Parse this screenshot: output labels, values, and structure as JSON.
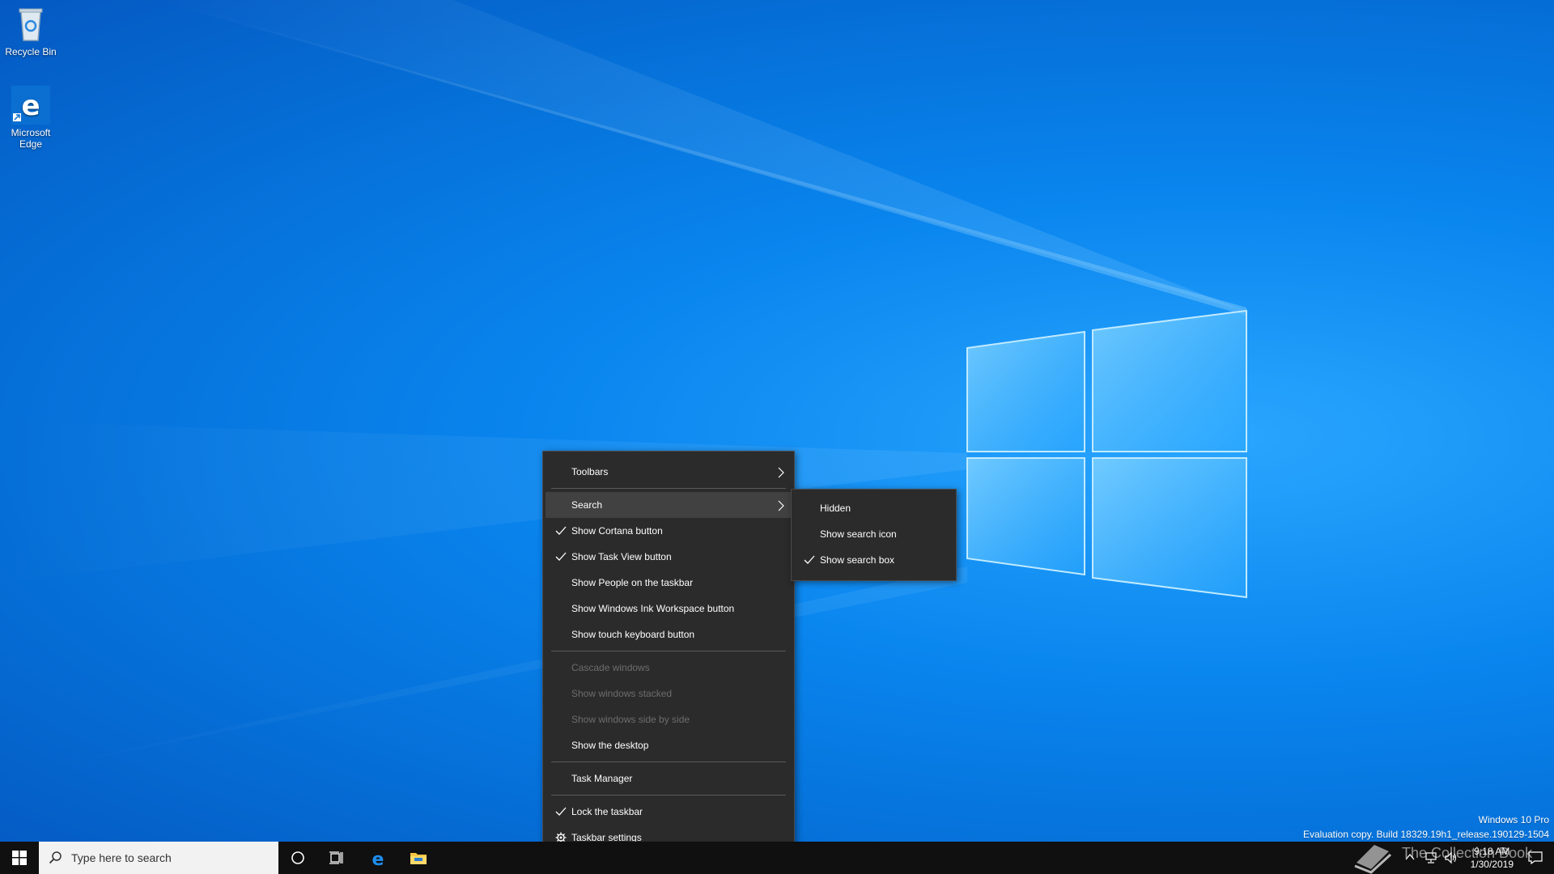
{
  "desktop": {
    "icons": [
      {
        "label": "Recycle Bin",
        "icon": "recycle-bin-icon"
      },
      {
        "label": "Microsoft Edge",
        "icon": "edge-icon"
      }
    ]
  },
  "context_menu": {
    "items": [
      {
        "label": "Toolbars",
        "checked": false,
        "submenu": true,
        "enabled": true
      },
      {
        "label": "Search",
        "checked": false,
        "submenu": true,
        "enabled": true,
        "highlighted": true
      },
      {
        "label": "Show Cortana button",
        "checked": true,
        "enabled": true
      },
      {
        "label": "Show Task View button",
        "checked": true,
        "enabled": true
      },
      {
        "label": "Show People on the taskbar",
        "checked": false,
        "enabled": true
      },
      {
        "label": "Show Windows Ink Workspace button",
        "checked": false,
        "enabled": true
      },
      {
        "label": "Show touch keyboard button",
        "checked": false,
        "enabled": true
      },
      {
        "label": "Cascade windows",
        "checked": false,
        "enabled": false
      },
      {
        "label": "Show windows stacked",
        "checked": false,
        "enabled": false
      },
      {
        "label": "Show windows side by side",
        "checked": false,
        "enabled": false
      },
      {
        "label": "Show the desktop",
        "checked": false,
        "enabled": true
      },
      {
        "label": "Task Manager",
        "checked": false,
        "enabled": true
      },
      {
        "label": "Lock the taskbar",
        "checked": true,
        "enabled": true
      },
      {
        "label": "Taskbar settings",
        "icon": "gear-icon",
        "enabled": true
      }
    ]
  },
  "search_submenu": {
    "items": [
      {
        "label": "Hidden",
        "checked": false
      },
      {
        "label": "Show search icon",
        "checked": false
      },
      {
        "label": "Show search box",
        "checked": true
      }
    ]
  },
  "taskbar": {
    "search_placeholder": "Type here to search",
    "pinned": [
      "start-icon",
      "cortana-icon",
      "task-view-icon",
      "edge-icon",
      "file-explorer-icon"
    ],
    "clock_time": "9:18 AM",
    "clock_date": "1/30/2019"
  },
  "watermark": {
    "line1": "Windows 10 Pro",
    "line2": "Evaluation copy. Build 18329.19h1_release.190129-1504"
  },
  "brand": {
    "text": "The Collection Book"
  },
  "colors": {
    "menu_bg": "#2b2b2b",
    "menu_highlight": "#414141",
    "taskbar_bg": "#101010",
    "desktop_blue": "#0a86ef"
  }
}
